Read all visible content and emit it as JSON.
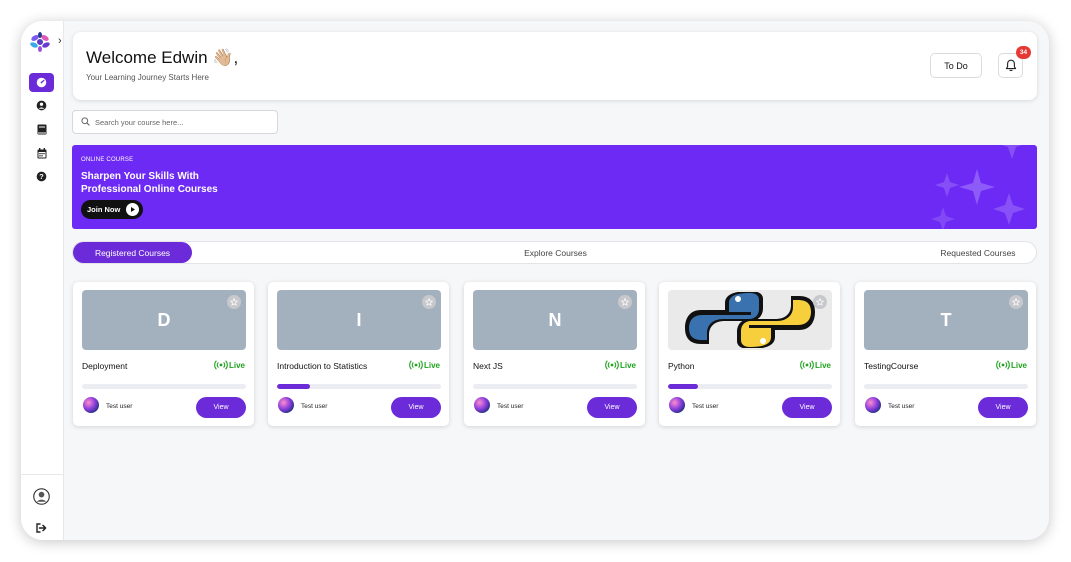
{
  "colors": {
    "accent": "#6c2bd9",
    "banner": "#6d2af5",
    "live": "#1fa31f",
    "badge": "#e53935"
  },
  "sidebar": {
    "expand_icon": "chevron-right-icon",
    "items": [
      {
        "name": "dashboard",
        "icon": "speedometer-icon",
        "active": true
      },
      {
        "name": "profile",
        "icon": "user-circle-icon",
        "active": false
      },
      {
        "name": "courses",
        "icon": "book-icon",
        "active": false
      },
      {
        "name": "calendar",
        "icon": "calendar-icon",
        "active": false
      },
      {
        "name": "help",
        "icon": "question-circle-icon",
        "active": false
      }
    ],
    "bottom": [
      {
        "name": "account",
        "icon": "account-circle-icon"
      },
      {
        "name": "logout",
        "icon": "logout-icon"
      }
    ]
  },
  "header": {
    "welcome": "Welcome Edwin 👋🏼,",
    "subtitle": "Your Learning Journey Starts Here",
    "todo_label": "To Do",
    "notifications_count": "34"
  },
  "search": {
    "placeholder": "Search your course here..."
  },
  "banner": {
    "kicker": "ONLINE COURSE",
    "title_line1": "Sharpen Your Skills With",
    "title_line2": "Professional Online Courses",
    "cta": "Join Now"
  },
  "tabs": [
    {
      "label": "Registered Courses",
      "active": true
    },
    {
      "label": "Explore Courses",
      "active": false
    },
    {
      "label": "Requested Courses",
      "active": false
    }
  ],
  "courses": [
    {
      "letter": "D",
      "title": "Deployment",
      "status": "Live",
      "progress": 0,
      "user": "Test user",
      "action": "View"
    },
    {
      "letter": "I",
      "title": "Introduction to Statistics",
      "status": "Live",
      "progress": 0.2,
      "user": "Test user",
      "action": "View"
    },
    {
      "letter": "N",
      "title": "Next JS",
      "status": "Live",
      "progress": 0,
      "user": "Test user",
      "action": "View"
    },
    {
      "letter": "",
      "title": "Python",
      "status": "Live",
      "progress": 0.18,
      "user": "Test user",
      "action": "View",
      "image": "python-logo"
    },
    {
      "letter": "T",
      "title": "TestingCourse",
      "status": "Live",
      "progress": 0,
      "user": "Test user",
      "action": "View"
    }
  ]
}
